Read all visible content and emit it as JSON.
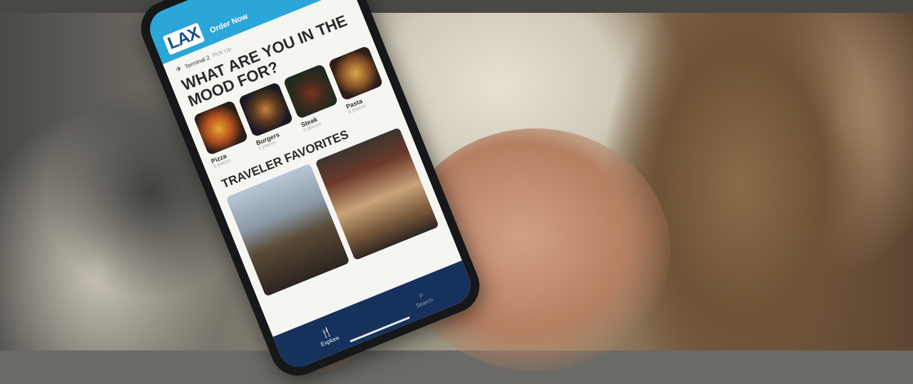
{
  "app": {
    "logo": "LAX",
    "header_label": "Order Now"
  },
  "location": {
    "terminal": "Terminal 2",
    "subtitle": "Pick Up"
  },
  "mood": {
    "title": "WHAT ARE YOU IN THE MOOD FOR?",
    "categories": [
      {
        "name": "Pizza",
        "count": "3 places"
      },
      {
        "name": "Burgers",
        "count": "5 places"
      },
      {
        "name": "Steak",
        "count": "3 places"
      },
      {
        "name": "Pasta",
        "count": "4 places"
      }
    ]
  },
  "favorites": {
    "title": "TRAVELER FAVORITES"
  },
  "tabbar": {
    "items": [
      {
        "label": "Explore",
        "icon": "fork-knife-icon"
      },
      {
        "label": "Search",
        "icon": "search-icon"
      }
    ]
  }
}
